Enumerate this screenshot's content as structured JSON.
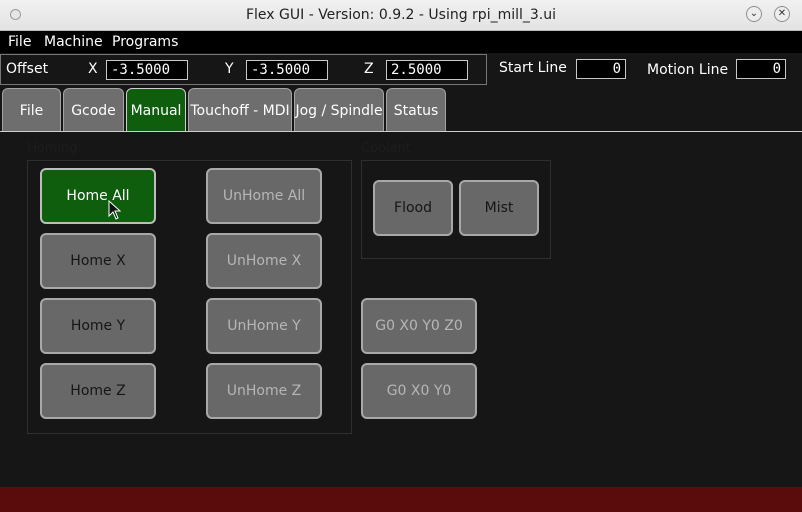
{
  "window": {
    "title": "Flex GUI - Version: 0.9.2 - Using rpi_mill_3.ui"
  },
  "menu": [
    "File",
    "Machine",
    "Programs"
  ],
  "offset": {
    "label": "Offset",
    "x_label": "X",
    "x_value": "-3.5000",
    "y_label": "Y",
    "y_value": "-3.5000",
    "z_label": "Z",
    "z_value": "2.5000"
  },
  "lines": {
    "start_label": "Start Line",
    "start_value": "0",
    "motion_label": "Motion Line",
    "motion_value": "0"
  },
  "tabs": [
    "File",
    "Gcode",
    "Manual",
    "Touchoff - MDI",
    "Jog / Spindle",
    "Status"
  ],
  "active_tab": "Manual",
  "homing": {
    "label": "Homing",
    "home": [
      "Home All",
      "Home X",
      "Home Y",
      "Home Z"
    ],
    "unhome": [
      "UnHome All",
      "UnHome X",
      "UnHome Y",
      "UnHome Z"
    ]
  },
  "coolant": {
    "label": "Coolant",
    "buttons": [
      "Flood",
      "Mist"
    ]
  },
  "goto": [
    "G0 X0 Y0 Z0",
    "G0 X0 Y0"
  ],
  "colors": {
    "active_green": "#0e5e0e",
    "status_red": "#5a0c0c",
    "button_gray": "#686868"
  },
  "icons": {
    "window_menu": "circle-icon",
    "minimize": "chevron-down-icon",
    "close": "close-icon",
    "cursor": "mouse-pointer-icon"
  }
}
